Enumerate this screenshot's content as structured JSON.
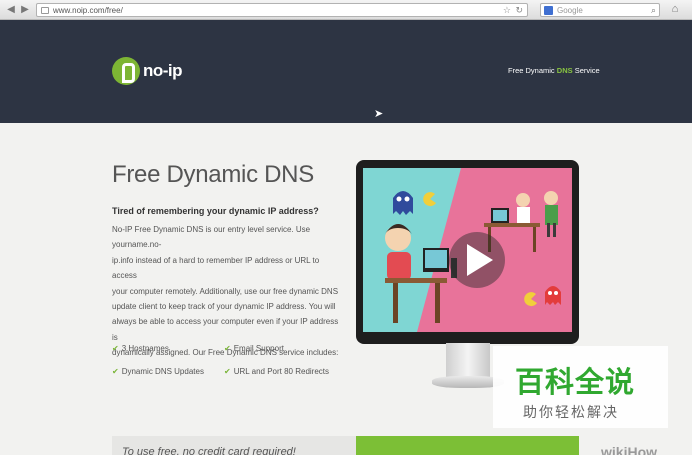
{
  "browser": {
    "url": "www.noip.com/free/",
    "search_placeholder": "Google"
  },
  "header": {
    "logo_text": "no-ip",
    "tagline_prefix": "Free Dynamic",
    "tagline_highlight": "DNS",
    "tagline_suffix": "Service"
  },
  "main": {
    "title": "Free Dynamic DNS",
    "subheading": "Tired of remembering your dynamic IP address?",
    "lines": [
      "No-IP Free Dynamic DNS is our entry level service. Use yourname.no-",
      "ip.info instead of a hard to remember IP address or URL to access",
      "your computer remotely. Additionally, use our free dynamic DNS",
      "update client to keep track of your dynamic IP address. You will",
      "always be able to access your computer even if your IP address is",
      "dynamically assigned. Our Free Dynamic DNS service includes:"
    ],
    "features": [
      "3 Hostnames",
      "Email Support",
      "Dynamic DNS Updates",
      "URL and Port 80 Redirects"
    ]
  },
  "watermark": {
    "main": "百科全说",
    "sub": "助你轻松解决"
  },
  "bottom": {
    "signup": "To use free, no credit card required!",
    "wikihow": "wikiHow"
  },
  "colors": {
    "header_bg": "#2d3443",
    "accent_green": "#7cbf36",
    "video_teal": "#7fd6d3",
    "video_pink": "#e8739a"
  }
}
